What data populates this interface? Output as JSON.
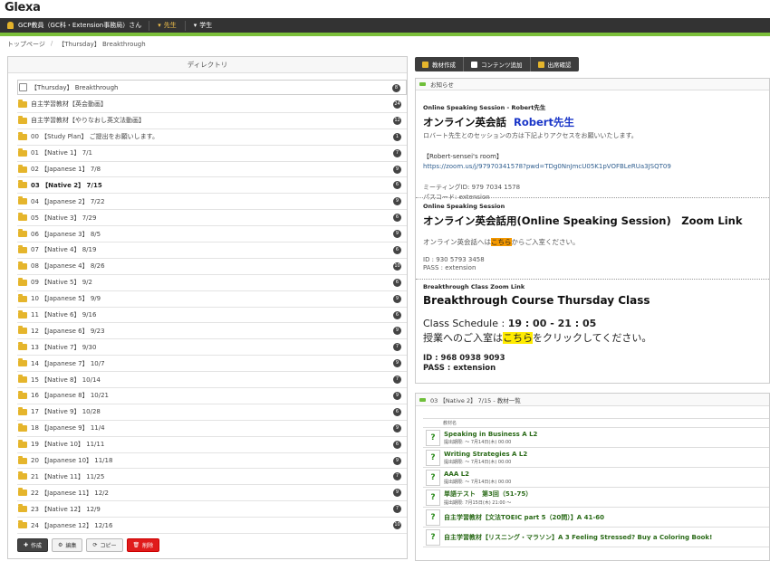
{
  "app": {
    "logo": "Glexa"
  },
  "navbar": {
    "user": "GCP教員（GC科・Extension事務局）さん",
    "items": [
      {
        "label": "先生",
        "active": true
      },
      {
        "label": "学生",
        "active": false
      }
    ]
  },
  "breadcrumb": [
    "トップページ",
    "【Thursday】 Breakthrough"
  ],
  "directory": {
    "title": "ディレクトリ",
    "items": [
      {
        "label": "【Thursday】 Breakthrough",
        "badge": "8",
        "type": "doc",
        "bold": false
      },
      {
        "label": "自主学習教材【英会動画】",
        "badge": "24",
        "type": "folder",
        "bold": false
      },
      {
        "label": "自主学習教材【やりなおし英文法動画】",
        "badge": "12",
        "type": "folder",
        "bold": false
      },
      {
        "label": "00 【Study Plan】 ご提出をお願いします。",
        "badge": "1",
        "type": "folder",
        "bold": false
      },
      {
        "label": "01 【Native 1】 7/1",
        "badge": "7",
        "type": "folder",
        "bold": false
      },
      {
        "label": "02 【Japanese 1】 7/8",
        "badge": "9",
        "type": "folder",
        "bold": false
      },
      {
        "label": "03 【Native 2】 7/15",
        "badge": "6",
        "type": "folder",
        "bold": true
      },
      {
        "label": "04 【Japanese 2】 7/22",
        "badge": "9",
        "type": "folder",
        "bold": false
      },
      {
        "label": "05 【Native 3】 7/29",
        "badge": "6",
        "type": "folder",
        "bold": false
      },
      {
        "label": "06 【Japanese 3】 8/5",
        "badge": "9",
        "type": "folder",
        "bold": false
      },
      {
        "label": "07 【Native 4】 8/19",
        "badge": "6",
        "type": "folder",
        "bold": false
      },
      {
        "label": "08 【Japanese 4】 8/26",
        "badge": "10",
        "type": "folder",
        "bold": false
      },
      {
        "label": "09 【Native 5】 9/2",
        "badge": "6",
        "type": "folder",
        "bold": false
      },
      {
        "label": "10 【Japanese 5】 9/9",
        "badge": "9",
        "type": "folder",
        "bold": false
      },
      {
        "label": "11 【Native 6】 9/16",
        "badge": "6",
        "type": "folder",
        "bold": false
      },
      {
        "label": "12 【Japanese 6】 9/23",
        "badge": "9",
        "type": "folder",
        "bold": false
      },
      {
        "label": "13 【Native 7】 9/30",
        "badge": "7",
        "type": "folder",
        "bold": false
      },
      {
        "label": "14 【Japanese 7】 10/7",
        "badge": "9",
        "type": "folder",
        "bold": false
      },
      {
        "label": "15 【Native 8】 10/14",
        "badge": "7",
        "type": "folder",
        "bold": false
      },
      {
        "label": "16 【Japanese 8】 10/21",
        "badge": "9",
        "type": "folder",
        "bold": false
      },
      {
        "label": "17 【Native 9】 10/28",
        "badge": "6",
        "type": "folder",
        "bold": false
      },
      {
        "label": "18 【Japanese 9】 11/4",
        "badge": "9",
        "type": "folder",
        "bold": false
      },
      {
        "label": "19 【Native 10】 11/11",
        "badge": "6",
        "type": "folder",
        "bold": false
      },
      {
        "label": "20 【Japanese 10】 11/18",
        "badge": "9",
        "type": "folder",
        "bold": false
      },
      {
        "label": "21 【Native 11】 11/25",
        "badge": "7",
        "type": "folder",
        "bold": false
      },
      {
        "label": "22 【Japanese 11】 12/2",
        "badge": "9",
        "type": "folder",
        "bold": false
      },
      {
        "label": "23 【Native 12】 12/9",
        "badge": "7",
        "type": "folder",
        "bold": false
      },
      {
        "label": "24 【Japanese 12】 12/16",
        "badge": "10",
        "type": "folder",
        "bold": false
      }
    ],
    "buttons": {
      "create": "作成",
      "edit": "編集",
      "copy": "コピー",
      "delete": "削除"
    }
  },
  "toolbar": {
    "material_create": "教材作成",
    "content_add": "コンテンツ追加",
    "attendance": "出席確認"
  },
  "notice": {
    "title": "お知らせ",
    "s1": {
      "small": "Online Speaking Session - Robert先生",
      "big": "オンライン英会話",
      "big_blue": "Robert先生",
      "desc": "ロバート先生とのセッションの方は下記よりアクセスをお願いいたします。",
      "room": "【Robert-sensei's room】",
      "url": "https://zoom.us/j/97970341578?pwd=TDg0NnJmcU05K1pVOFBLeRUa3JSQT09",
      "meeting": "ミーティングID: 979 7034 1578",
      "pass": "パスコード: extension"
    },
    "s2": {
      "small": "Online Speaking Session",
      "big": "オンライン英会話用(Online Speaking Session)　Zoom Link",
      "desc_a": "オンライン英会話へは",
      "desc_hl": "こちら",
      "desc_b": "からご入室ください。",
      "id": "ID : 930 5793 3458",
      "pass": "PASS : extension"
    },
    "s3": {
      "small": "Breakthrough Class Zoom Link",
      "big": "Breakthrough Course Thursday Class",
      "schedule_label": "Class Schedule :",
      "schedule_time": "19 : 00 - 21 : 05",
      "line_a": "授業へのご入室は",
      "line_hl": "こちら",
      "line_b": "をクリックしてください。",
      "id": "ID : 968 0938 9093",
      "pass": "PASS :  extension"
    }
  },
  "materials": {
    "title": "03 【Native 2】 7/15 - 教材一覧",
    "head": "教材名",
    "rows": [
      {
        "title": "Speaking in Business A L2",
        "date": "提出期限: ～ 7月14日(木) 00:00"
      },
      {
        "title": "Writing Strategies A L2",
        "date": "提出期限: ～ 7月14日(木) 00:00"
      },
      {
        "title": "AAA L2",
        "date": "提出期限: ～ 7月14日(木) 00:00"
      },
      {
        "title": "単語テスト　第3回（51-75）",
        "date": "提出期限: 7月15日(木) 21:00 ～"
      },
      {
        "title": "自主学習教材【文法TOEIC part 5（20問）】A 41-60",
        "date": ""
      },
      {
        "title": "自主学習教材【リスニング・マラソン】A 3 Feeling Stressed? Buy a Coloring Book!",
        "date": ""
      }
    ]
  }
}
